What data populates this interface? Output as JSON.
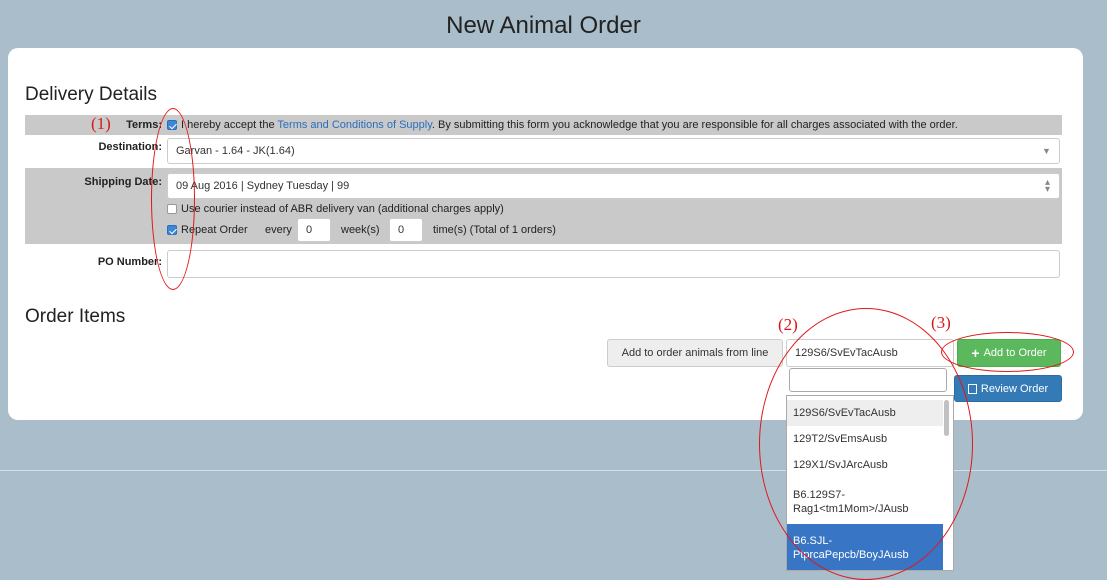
{
  "page_title": "New Animal Order",
  "delivery": {
    "section_title": "Delivery Details",
    "terms_label": "Terms:",
    "terms_text_before": "I hereby accept the",
    "terms_link": "Terms and Conditions of Supply",
    "terms_text_after": ". By submitting this form you acknowledge that you are responsible for all charges associated with the order.",
    "terms_checked": true,
    "destination_label": "Destination:",
    "destination_value": "Garvan - 1.64 - JK(1.64)",
    "shipping_label": "Shipping Date:",
    "shipping_value": "09 Aug 2016 | Sydney Tuesday | 99",
    "courier_text": "Use courier instead of ABR delivery van (additional charges apply)",
    "courier_checked": false,
    "repeat_label": "Repeat Order",
    "repeat_checked": true,
    "every_label": "every",
    "every_value": "0",
    "weeks_label": "week(s)",
    "times_value": "0",
    "times_label": "time(s) (Total of 1 orders)",
    "po_label": "PO Number:",
    "po_value": ""
  },
  "order_items": {
    "section_title": "Order Items",
    "add_from_line_label": "Add to order animals from line",
    "selected_line": "129S6/SvEvTacAusb",
    "add_button": "Add to Order",
    "review_button": "Review Order",
    "dropdown_search": "",
    "dropdown_options": [
      "129S6/SvEvTacAusb",
      "129T2/SvEmsAusb",
      "129X1/SvJArcAusb",
      "B6.129S7-\nRag1<tm1Mom>/JAusb",
      "B6.SJL-\nPtprcaPepcb/BoyJAusb"
    ]
  },
  "annotations": [
    "(1)",
    "(2)",
    "(3)"
  ],
  "colors": {
    "background": "#a9bdcb",
    "accent_green": "#5cb85c",
    "accent_blue": "#337ab7",
    "annotation_red": "#e01818"
  }
}
